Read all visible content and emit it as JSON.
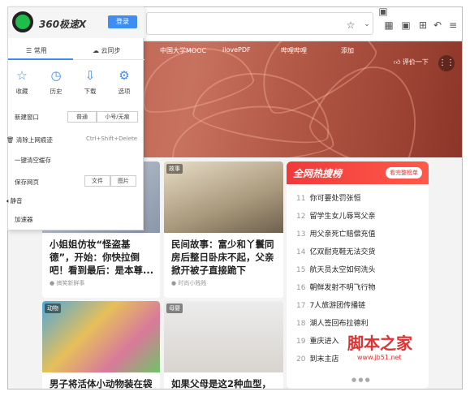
{
  "popup": {
    "brand": "360极速X",
    "login": "登录",
    "tabs": [
      "常用",
      "云同步"
    ],
    "quick": [
      "收藏",
      "历史",
      "下载",
      "选项"
    ],
    "new_window": "新建窗口",
    "new_window_opts": [
      "普通",
      "小号/无痕"
    ],
    "clear_history": "清除上网痕迹",
    "clear_shortcut": "Ctrl+Shift+Delete",
    "one_click_clear": "一键清空缓存",
    "save_page": "保存网页",
    "save_opts": [
      "文件",
      "图片"
    ],
    "mute": "静音",
    "accelerator": "加速器"
  },
  "bookmarks": [
    "中国大学MOOC",
    "ilovePDF",
    "哔哩哔哩",
    "添加"
  ],
  "weather": "评价一下",
  "cards": [
    {
      "title": "小姐姐仿妆“怪盗基德”，开始：你快拉倒吧！看到最后：是本尊...",
      "source": "搞笑新鲜事"
    },
    {
      "tag": "故事",
      "title": "民间故事：富少和丫鬟同房后整日卧床不起，父亲掀开被子直接跪下",
      "source": "时尚小贱贱"
    },
    {
      "tag": "动物",
      "title": "男子将活体小动物装在袋"
    },
    {
      "tag": "母婴",
      "title": "如果父母是这2种血型，"
    }
  ],
  "hot": {
    "title": "全网热搜榜",
    "button": "看完整榜单",
    "items": [
      {
        "n": "11",
        "t": "你可要处罚张恒"
      },
      {
        "n": "12",
        "t": "留学生女儿辱骂父亲"
      },
      {
        "n": "13",
        "t": "用父亲死亡赔偿充值"
      },
      {
        "n": "14",
        "t": "亿双耐克鞋无法交货"
      },
      {
        "n": "15",
        "t": "航天员太空如何洗头"
      },
      {
        "n": "16",
        "t": "朝鲜发射不明飞行物"
      },
      {
        "n": "17",
        "t": "7人旅游团传播链"
      },
      {
        "n": "18",
        "t": "湖人签回布拉德利"
      },
      {
        "n": "19",
        "t": "重庆进入"
      },
      {
        "n": "20",
        "t": "到末主店"
      }
    ]
  },
  "watermark": "脚本之家",
  "watermark_url": "www.jb51.net"
}
